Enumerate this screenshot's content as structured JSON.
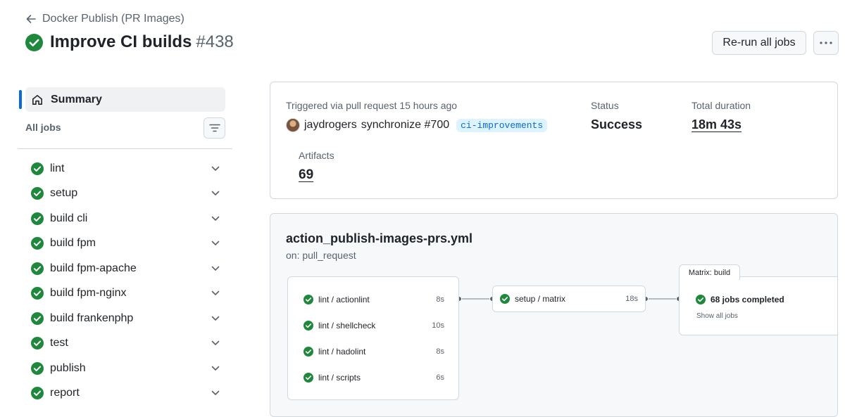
{
  "header": {
    "back_link": "Docker Publish (PR Images)",
    "title": "Improve CI builds",
    "run_number": "#438",
    "rerun_label": "Re-run all jobs",
    "more_icon": "kebab-horizontal-icon"
  },
  "sidebar": {
    "summary_label": "Summary",
    "all_jobs_label": "All jobs",
    "jobs": [
      {
        "label": "lint"
      },
      {
        "label": "setup"
      },
      {
        "label": "build cli"
      },
      {
        "label": "build fpm"
      },
      {
        "label": "build fpm-apache"
      },
      {
        "label": "build fpm-nginx"
      },
      {
        "label": "build frankenphp"
      },
      {
        "label": "test"
      },
      {
        "label": "publish"
      },
      {
        "label": "report"
      }
    ]
  },
  "summary": {
    "trigger_text": "Triggered via pull request 15 hours ago",
    "actor": "jaydrogers",
    "action": "synchronize #700",
    "branch": "ci-improvements",
    "status_label": "Status",
    "status_value": "Success",
    "duration_label": "Total duration",
    "duration_value": "18m 43s",
    "artifacts_label": "Artifacts",
    "artifacts_value": "69"
  },
  "workflow": {
    "file": "action_publish-images-prs.yml",
    "trigger": "on: pull_request",
    "lint_jobs": [
      {
        "label": "lint / actionlint",
        "duration": "8s"
      },
      {
        "label": "lint / shellcheck",
        "duration": "10s"
      },
      {
        "label": "lint / hadolint",
        "duration": "8s"
      },
      {
        "label": "lint / scripts",
        "duration": "6s"
      }
    ],
    "setup_job": {
      "label": "setup / matrix",
      "duration": "18s"
    },
    "matrix": {
      "tab_label": "Matrix: build",
      "completed": "68 jobs completed",
      "show_all": "Show all jobs"
    }
  },
  "colors": {
    "success": "#1f883d",
    "accent": "#0969da",
    "border": "#d1d9e0",
    "muted_text": "#59636e"
  }
}
